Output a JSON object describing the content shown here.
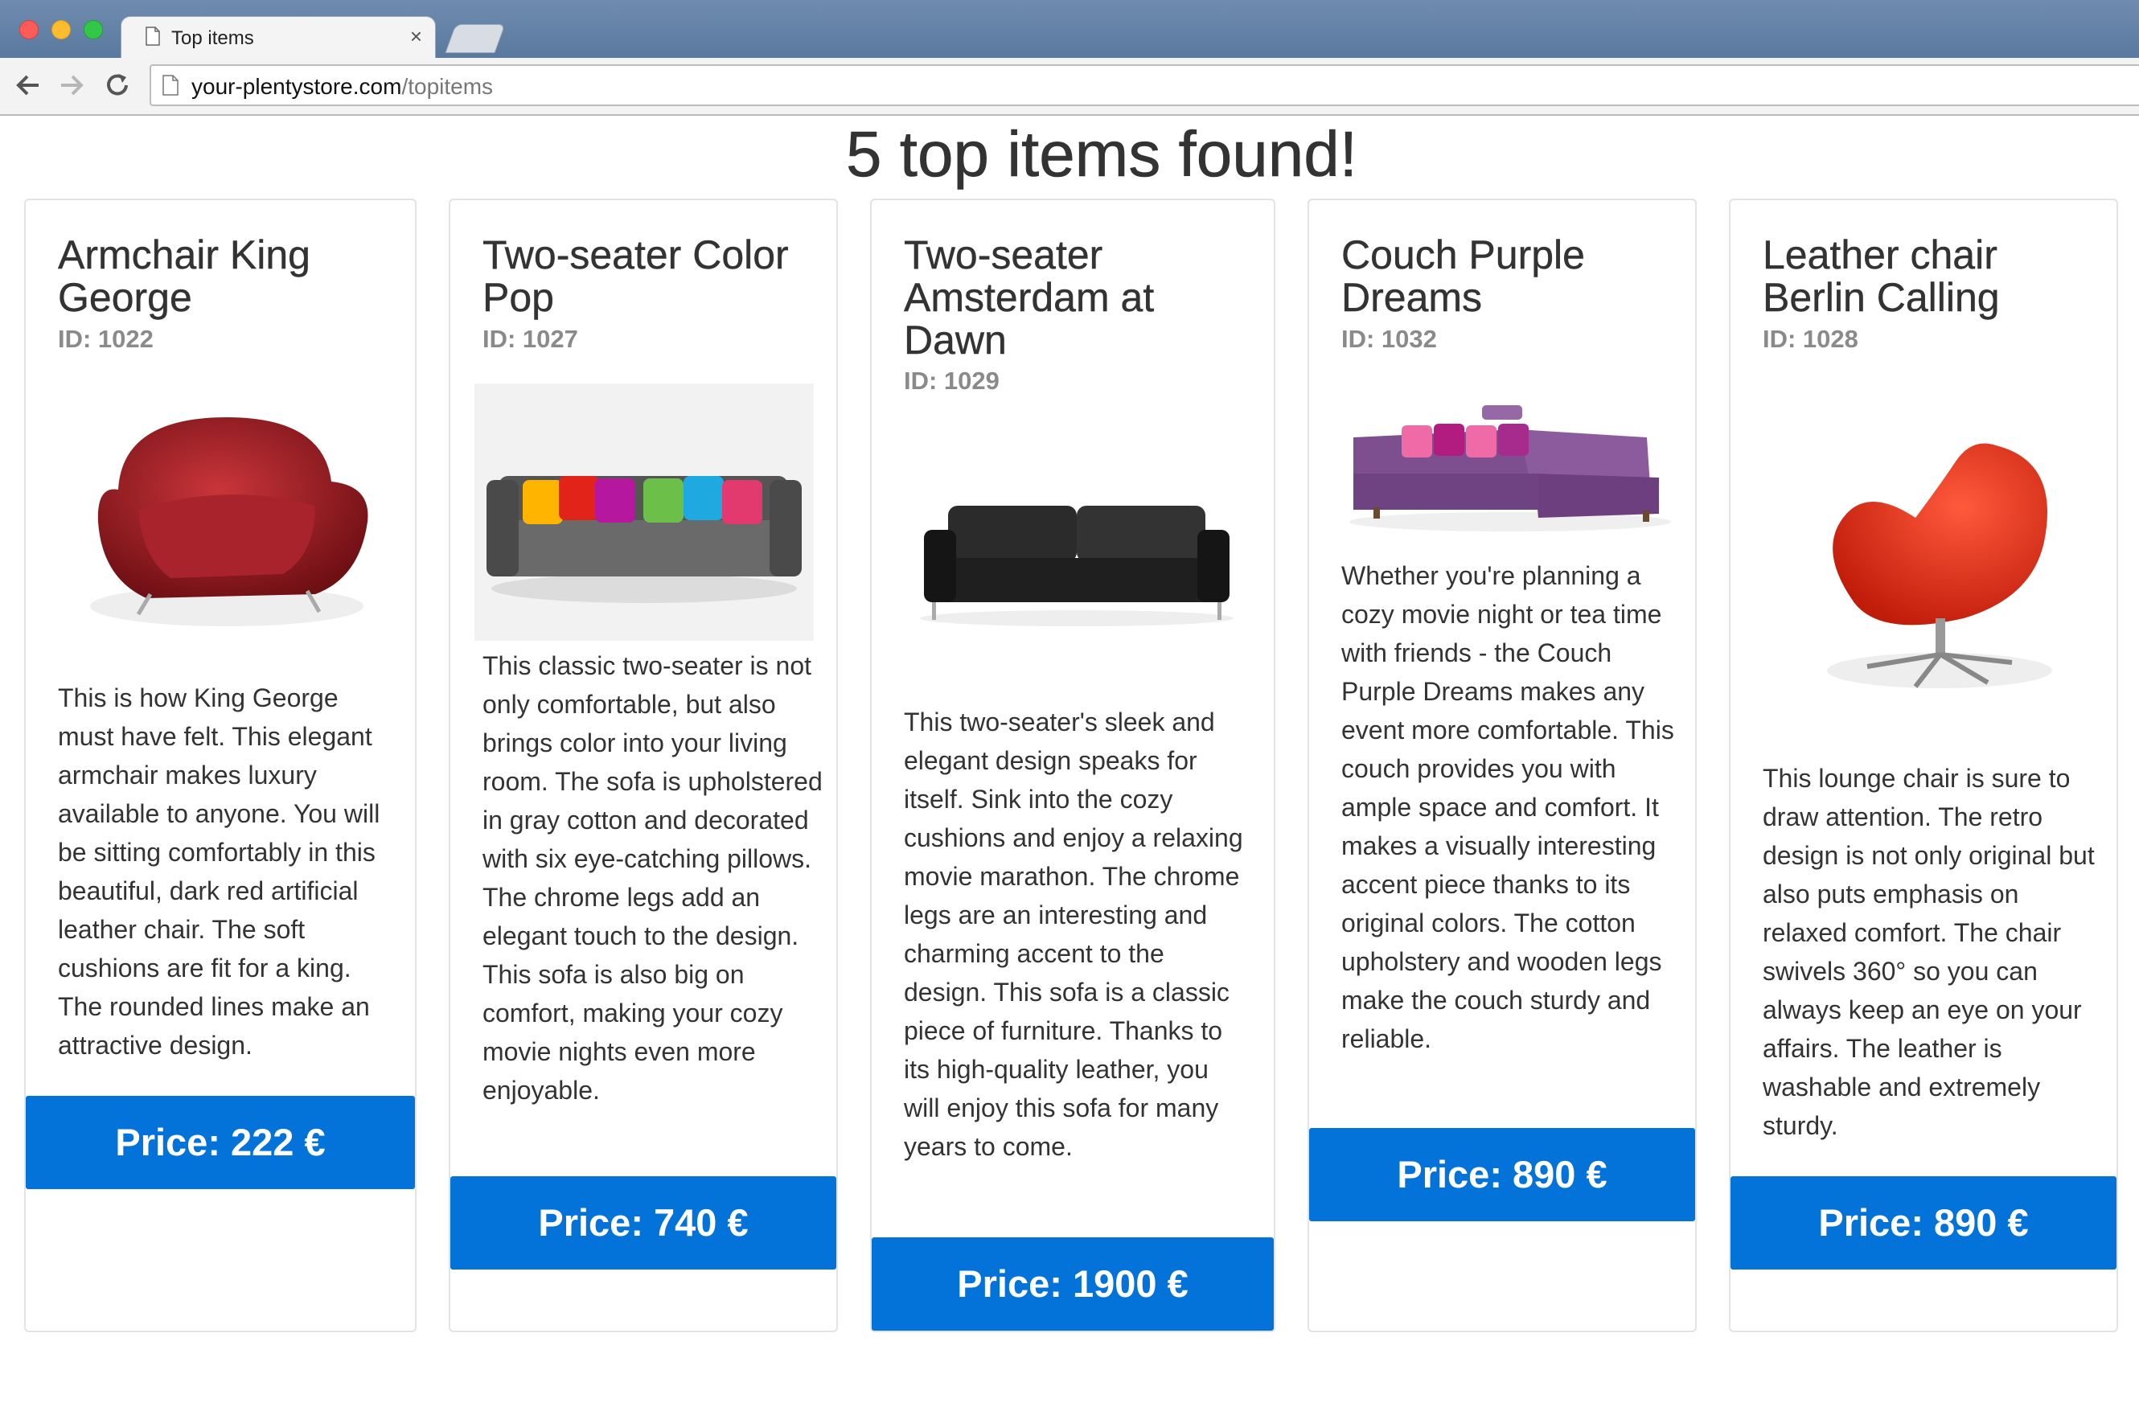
{
  "browser": {
    "tab_title": "Top items",
    "tab_close": "×",
    "url_host": "your-plentystore.com",
    "url_path": "/topitems",
    "icons": [
      "page-icon",
      "back-arrow-icon",
      "forward-arrow-icon",
      "reload-icon",
      "close-icon"
    ]
  },
  "page": {
    "heading": "5 top items found!",
    "accent_color": "#0373d9"
  },
  "items": [
    {
      "title": "Armchair King George",
      "id": "ID: 1022",
      "image": "red-leather-armchair",
      "description": "This is how King George must have felt. This elegant armchair makes luxury available to anyone. You will be sitting comfortably in this beautiful, dark red artificial leather chair. The soft cushions are fit for a king. The rounded lines make an attractive design.",
      "price": "Price: 222 €"
    },
    {
      "title": "Two-seater Color Pop",
      "id": "ID: 1027",
      "image": "gray-sofa-colorful-pillows",
      "description": "This classic two-seater is not only comfortable, but also brings color into your living room. The sofa is upholstered in gray cotton and decorated with six eye-catching pillows. The chrome legs add an elegant touch to the design. This sofa is also big on comfort, making your cozy movie nights even more enjoyable.",
      "price": "Price: 740 €"
    },
    {
      "title": "Two-seater Amsterdam at Dawn",
      "id": "ID: 1029",
      "image": "black-leather-sofa",
      "description": "This two-seater's sleek and elegant design speaks for itself. Sink into the cozy cushions and enjoy a relaxing movie marathon. The chrome legs are an interesting and charming accent to the design. This sofa is a classic piece of furniture. Thanks to its high-quality leather, you will enjoy this sofa for many years to come.",
      "price": "Price: 1900 €"
    },
    {
      "title": "Couch Purple Dreams",
      "id": "ID: 1032",
      "image": "purple-corner-couch",
      "description": "Whether you're planning a cozy movie night or tea time with friends - the Couch Purple Dreams makes any event more comfortable. This couch provides you with ample space and comfort. It makes a visually interesting accent piece thanks to its original colors. The cotton upholstery and wooden legs make the couch sturdy and reliable.",
      "price": "Price: 890 €"
    },
    {
      "title": "Leather chair Berlin Calling",
      "id": "ID: 1028",
      "image": "red-egg-chair",
      "description": "This lounge chair is sure to draw attention. The retro design is not only original but also puts emphasis on relaxed comfort. The chair swivels 360° so you can always keep an eye on your affairs. The leather is washable and extremely sturdy.",
      "price": "Price: 890 €"
    }
  ]
}
